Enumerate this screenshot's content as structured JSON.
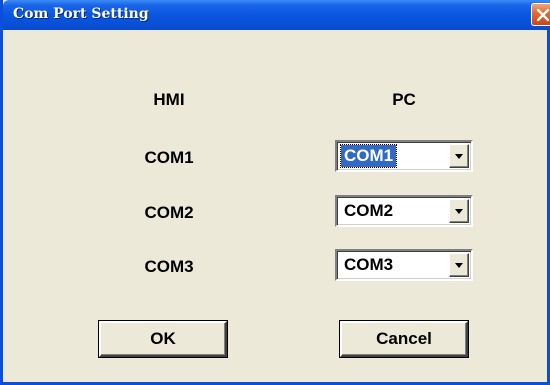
{
  "window": {
    "title": "Com Port Setting"
  },
  "headers": {
    "hmi": "HMI",
    "pc": "PC"
  },
  "rows": [
    {
      "hmi_label": "COM1",
      "pc_value": "COM1"
    },
    {
      "hmi_label": "COM2",
      "pc_value": "COM2"
    },
    {
      "hmi_label": "COM3",
      "pc_value": "COM3"
    }
  ],
  "buttons": {
    "ok": "OK",
    "cancel": "Cancel"
  },
  "icons": {
    "close": "close-icon",
    "dropdown": "chevron-down-icon"
  },
  "colors": {
    "titlebar": "#0a56e0",
    "selection": "#316ac5",
    "close_button": "#e2672e",
    "dialog_background": "#ece9d8"
  }
}
